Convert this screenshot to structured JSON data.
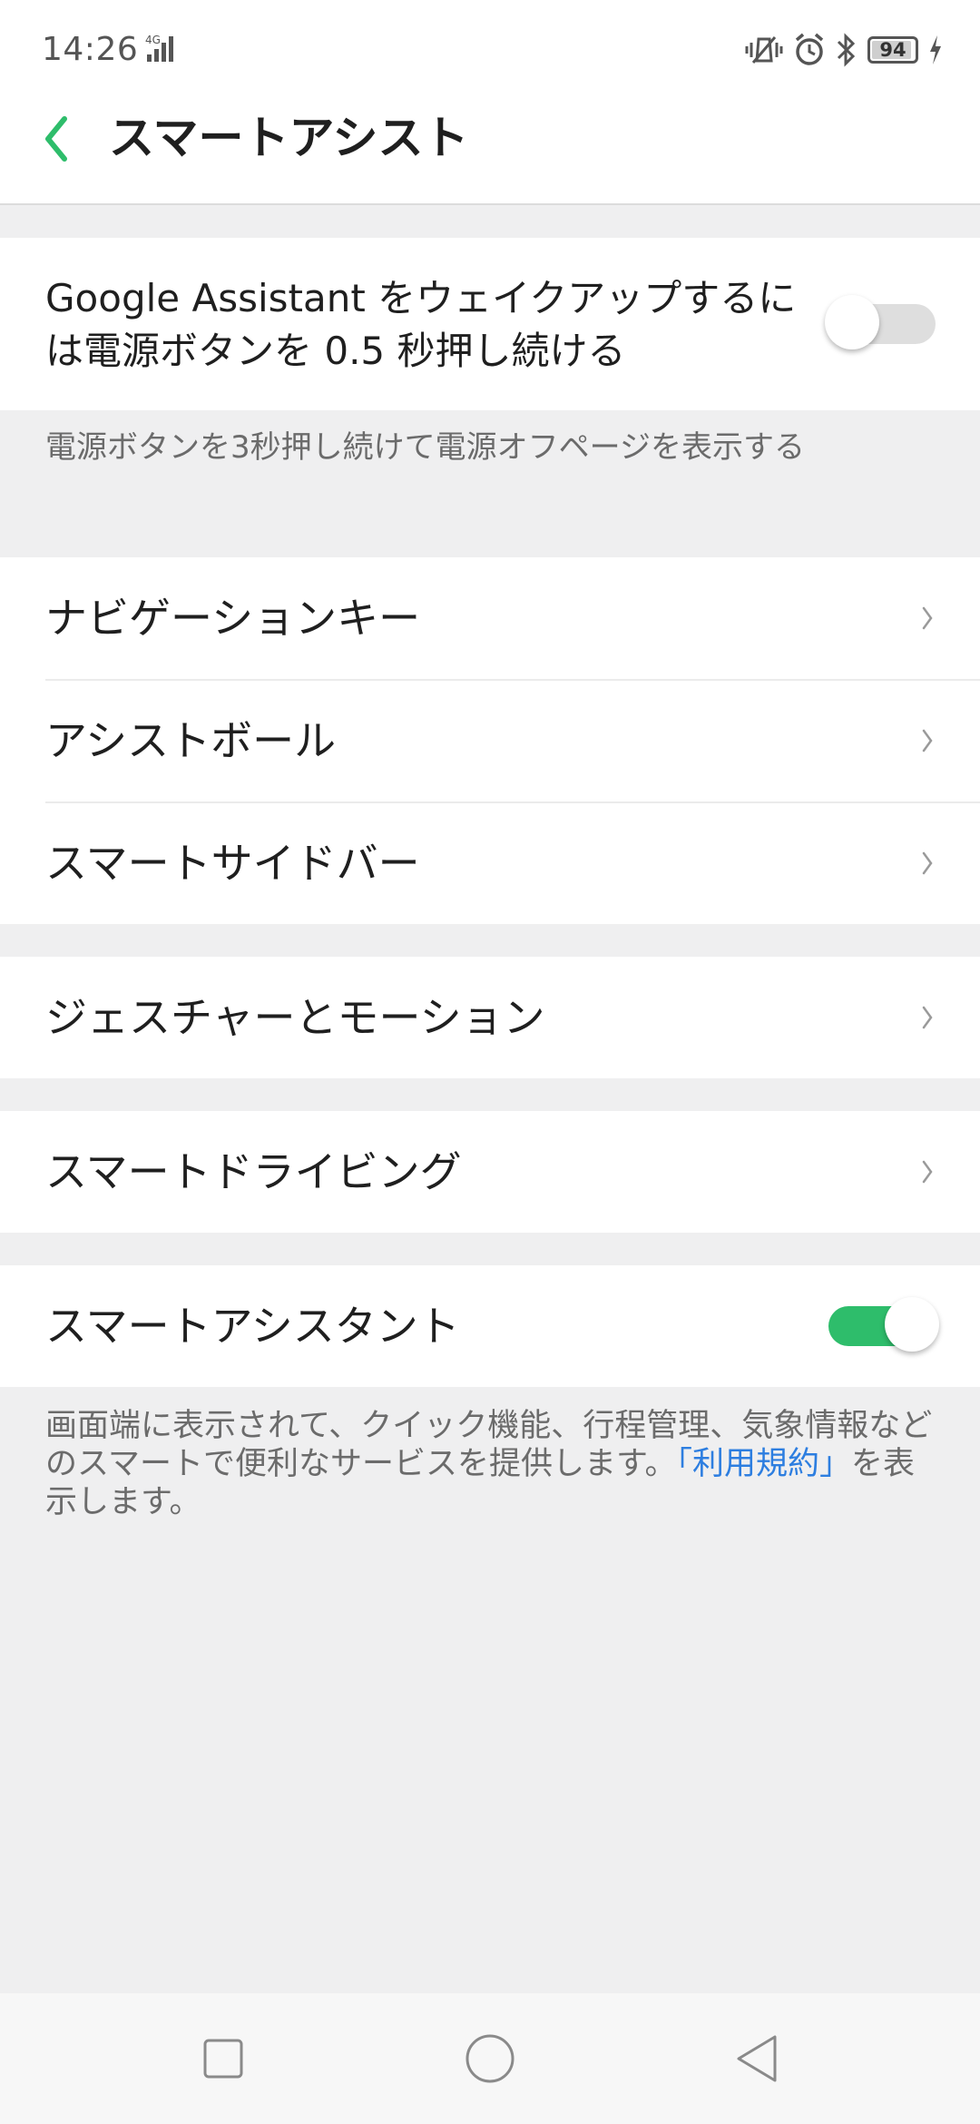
{
  "status_bar": {
    "time": "14:26",
    "network": "4G",
    "battery": "94",
    "battery_level": 0.94
  },
  "header": {
    "title": "スマートアシスト"
  },
  "google_assistant": {
    "label": "Google Assistant をウェイクアップするには電源ボタンを 0.5 秒押し続ける",
    "enabled": false,
    "description": "電源ボタンを3秒押し続けて電源オフページを表示する"
  },
  "menu_group_1": [
    {
      "label": "ナビゲーションキー"
    },
    {
      "label": "アシストボール"
    },
    {
      "label": "スマートサイドバー"
    }
  ],
  "gestures": {
    "label": "ジェスチャーとモーション"
  },
  "smart_driving": {
    "label": "スマートドライビング"
  },
  "smart_assistant": {
    "label": "スマートアシスタント",
    "enabled": true,
    "description_before": "画面端に表示されて、クイック機能、行程管理、気象情報などのスマートで便利なサービスを提供します。",
    "link": "「利用規約」",
    "description_after": "を表示します。"
  },
  "colors": {
    "accent": "#2ebd6b",
    "link": "#2d7ee0",
    "switch_off": "#dedede"
  }
}
